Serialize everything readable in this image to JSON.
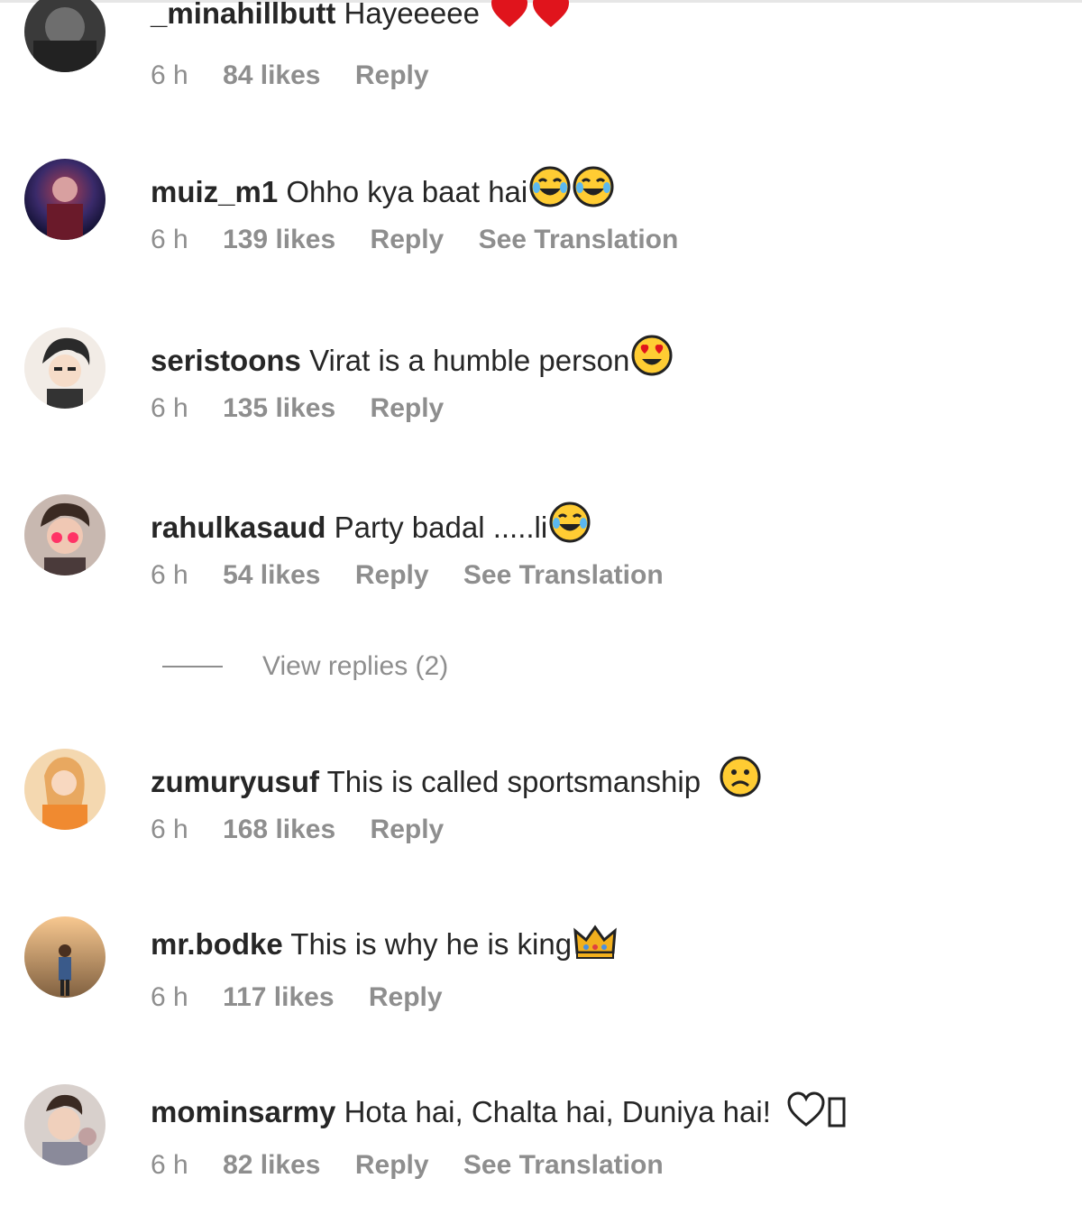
{
  "comments": [
    {
      "username": "_minahillbutt",
      "text": "Hayeeeee",
      "emojis": [
        "red-heart",
        "red-heart"
      ],
      "time": "6 h",
      "likes": "84 likes",
      "reply": "Reply",
      "translate": ""
    },
    {
      "username": "muiz_m1",
      "text": "Ohho kya baat hai",
      "emojis": [
        "tears-of-joy",
        "tears-of-joy"
      ],
      "time": "6 h",
      "likes": "139 likes",
      "reply": "Reply",
      "translate": "See Translation"
    },
    {
      "username": "seristoons",
      "text": "Virat is a humble person",
      "emojis": [
        "heart-eyes"
      ],
      "time": "6 h",
      "likes": "135 likes",
      "reply": "Reply",
      "translate": ""
    },
    {
      "username": "rahulkasaud",
      "text": "Party badal .....li",
      "emojis": [
        "tears-of-joy"
      ],
      "time": "6 h",
      "likes": "54 likes",
      "reply": "Reply",
      "translate": "See Translation"
    },
    {
      "username": "zumuryusuf",
      "text": "This is called sportsmanship",
      "emojis": [
        "frowning-face"
      ],
      "time": "6 h",
      "likes": "168 likes",
      "reply": "Reply",
      "translate": ""
    },
    {
      "username": "mr.bodke",
      "text": "This is why he is king",
      "emojis": [
        "crown"
      ],
      "time": "6 h",
      "likes": "117 likes",
      "reply": "Reply",
      "translate": ""
    },
    {
      "username": "mominsarmy",
      "text": "Hota hai, Chalta hai, Duniya hai!",
      "emojis": [
        "white-heart",
        "missing-glyph"
      ],
      "time": "6 h",
      "likes": "82 likes",
      "reply": "Reply",
      "translate": "See Translation"
    }
  ],
  "view_replies": {
    "label": "View replies (2)"
  }
}
